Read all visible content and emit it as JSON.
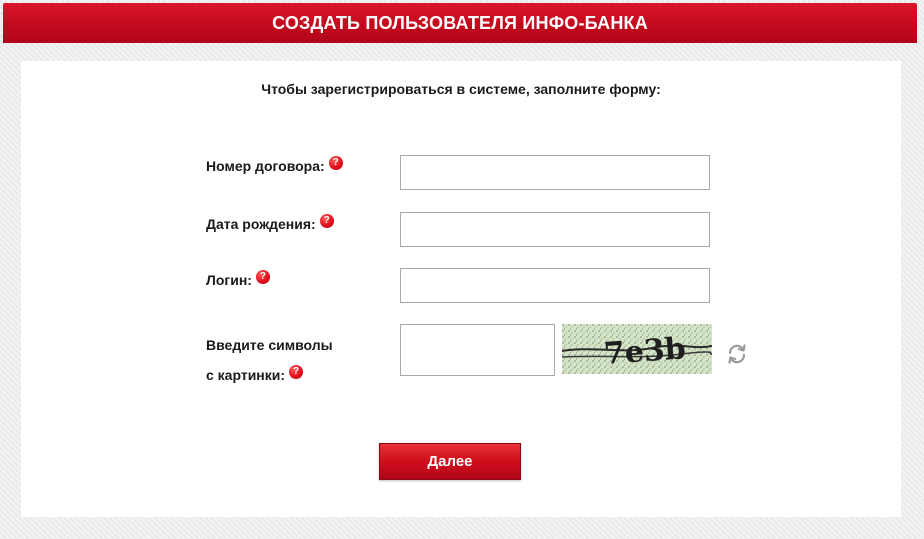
{
  "header": {
    "title": "СОЗДАТЬ ПОЛЬЗОВАТЕЛЯ ИНФО-БАНКА"
  },
  "form": {
    "intro": "Чтобы зарегистрироваться в системе, заполните форму:",
    "fields": [
      {
        "label": "Номер договора:",
        "value": "",
        "placeholder": ""
      },
      {
        "label": "Дата рождения:",
        "value": "",
        "placeholder": ""
      },
      {
        "label": "Логин:",
        "value": "",
        "placeholder": ""
      }
    ],
    "captcha": {
      "label_line1": "Введите символы",
      "label_line2": "с картинки:",
      "value": "",
      "image_text": "7e3b",
      "refresh_icon": "refresh-icon"
    },
    "help_icon": "question-circle-icon",
    "submit_label": "Далее"
  },
  "colors": {
    "brand_red": "#c8102e",
    "help_red": "#e3101c",
    "captcha_bg": "#d6e6c9"
  }
}
